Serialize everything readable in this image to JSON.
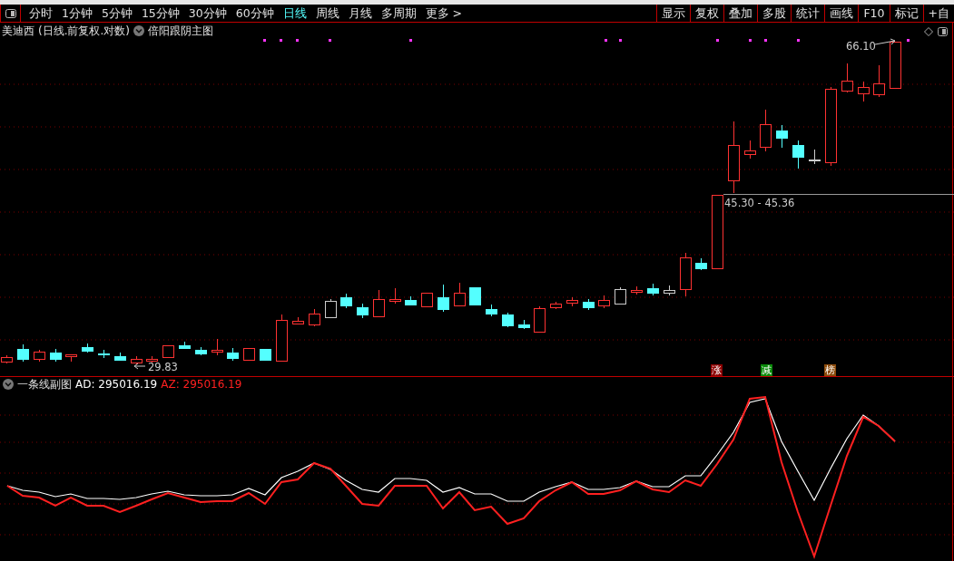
{
  "periods": [
    {
      "label": "分时",
      "selected": false
    },
    {
      "label": "1分钟",
      "selected": false
    },
    {
      "label": "5分钟",
      "selected": false
    },
    {
      "label": "15分钟",
      "selected": false
    },
    {
      "label": "30分钟",
      "selected": false
    },
    {
      "label": "60分钟",
      "selected": false
    },
    {
      "label": "日线",
      "selected": true
    },
    {
      "label": "周线",
      "selected": false
    },
    {
      "label": "月线",
      "selected": false
    },
    {
      "label": "多周期",
      "selected": false
    },
    {
      "label": "更多 >",
      "selected": false
    }
  ],
  "tools": [
    "显示",
    "复权",
    "叠加",
    "多股",
    "统计",
    "画线",
    "F10",
    "标记",
    "+自"
  ],
  "main_chart": {
    "stock": "美迪西",
    "mode": "(日线.前复权.对数)",
    "indicator": "倍阳跟阴主图",
    "high_label": "66.10",
    "range_label": "45.30 - 45.36",
    "low_label": "29.83",
    "badges": [
      {
        "text": "涨",
        "color": "#8b0000"
      },
      {
        "text": "减",
        "color": "#0a8a0a"
      },
      {
        "text": "榜",
        "color": "#8b4a0a"
      }
    ]
  },
  "sub_chart": {
    "indicator": "一条线副图",
    "ad": "AD: 295016.19",
    "az": "AZ: 295016.19"
  }
}
